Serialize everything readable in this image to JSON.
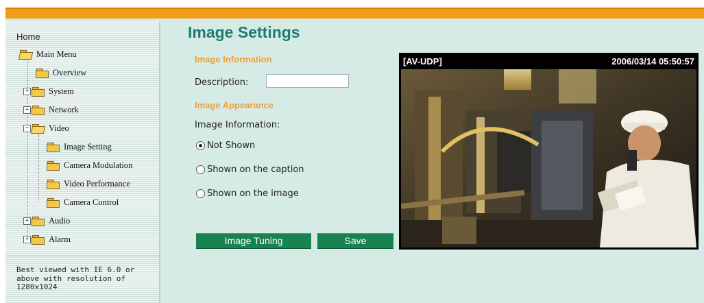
{
  "sidebar": {
    "home": "Home",
    "items": [
      {
        "label": "Main Menu"
      },
      {
        "label": "Overview"
      },
      {
        "label": "System"
      },
      {
        "label": "Network"
      },
      {
        "label": "Video"
      },
      {
        "label": "Image Setting"
      },
      {
        "label": "Camera Modulation"
      },
      {
        "label": "Video Performance"
      },
      {
        "label": "Camera Control"
      },
      {
        "label": "Audio"
      },
      {
        "label": "Alarm"
      }
    ],
    "note": "Best viewed with IE 6.0 or above with resolution of 1280x1024"
  },
  "main": {
    "title": "Image Settings",
    "image_information_heading": "Image Information",
    "description_label": "Description:",
    "description_value": "",
    "image_appearance_heading": "Image Appearance",
    "image_info_label": "Image Information:",
    "options": [
      {
        "label": "Not Shown",
        "checked": true
      },
      {
        "label": "Shown on the caption",
        "checked": false
      },
      {
        "label": "Shown on the image",
        "checked": false
      }
    ],
    "buttons": {
      "tuning": "Image Tuning",
      "save": "Save"
    }
  },
  "preview": {
    "camera_name": "[AV-UDP]",
    "timestamp": "2006/03/14 05:50:57"
  },
  "colors": {
    "accent_orange": "#f39c18",
    "title_teal": "#1d7c70",
    "section_orange": "#f0a030",
    "button_green": "#1a8150",
    "panel_bg": "#d7ebe6"
  }
}
